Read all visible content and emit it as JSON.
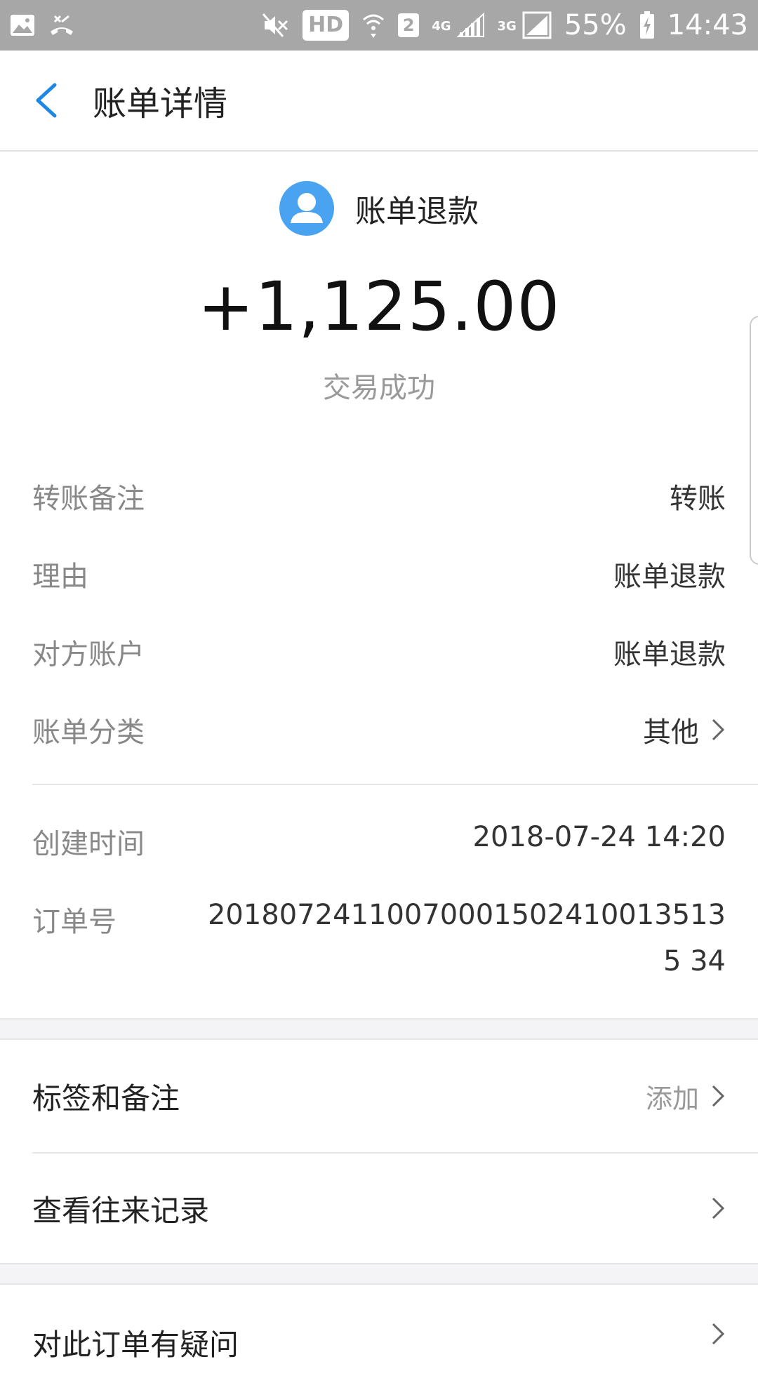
{
  "status_bar": {
    "hd": "HD",
    "sim": "2",
    "net_4g": "4G",
    "net_3g": "3G",
    "battery": "55%",
    "time": "14:43"
  },
  "app_bar": {
    "title": "账单详情"
  },
  "header": {
    "party_name": "账单退款",
    "amount": "+1,125.00",
    "status": "交易成功"
  },
  "details": {
    "remark_label": "转账备注",
    "remark_value": "转账",
    "reason_label": "理由",
    "reason_value": "账单退款",
    "counterparty_label": "对方账户",
    "counterparty_value": "账单退款",
    "category_label": "账单分类",
    "category_value": "其他",
    "created_label": "创建时间",
    "created_value": "2018-07-24 14:20",
    "order_label": "订单号",
    "order_value": "201807241100700015024100135135 34"
  },
  "actions": {
    "tags_label": "标签和备注",
    "tags_hint": "添加",
    "history_label": "查看往来记录",
    "question_label": "对此订单有疑问"
  }
}
